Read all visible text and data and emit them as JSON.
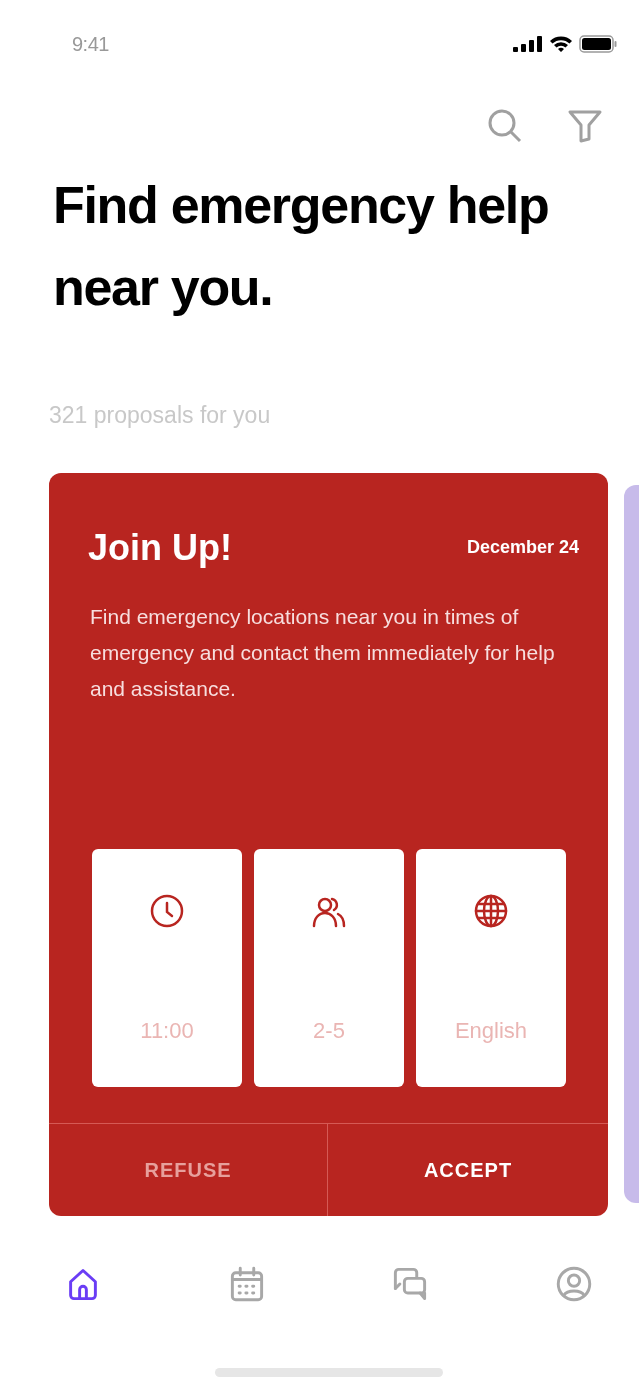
{
  "status_bar": {
    "time": "9:41"
  },
  "heading": "Find emergency help near you.",
  "subtitle": "321 proposals for you",
  "card": {
    "title": "Join Up!",
    "date": "December 24",
    "description": "Find emergency locations near you in times of emergency and contact them immediately for help and assistance.",
    "details": [
      {
        "kind": "time",
        "value": "11:00"
      },
      {
        "kind": "people",
        "value": "2-5"
      },
      {
        "kind": "language",
        "value": "English"
      }
    ],
    "actions": [
      {
        "label": "REFUSE",
        "kind": "secondary"
      },
      {
        "label": "ACCEPT",
        "kind": "primary"
      }
    ]
  },
  "nav": [
    {
      "kind": "home",
      "selected": true
    },
    {
      "kind": "calendar",
      "selected": false
    },
    {
      "kind": "chat",
      "selected": false
    },
    {
      "kind": "profile",
      "selected": false
    }
  ]
}
